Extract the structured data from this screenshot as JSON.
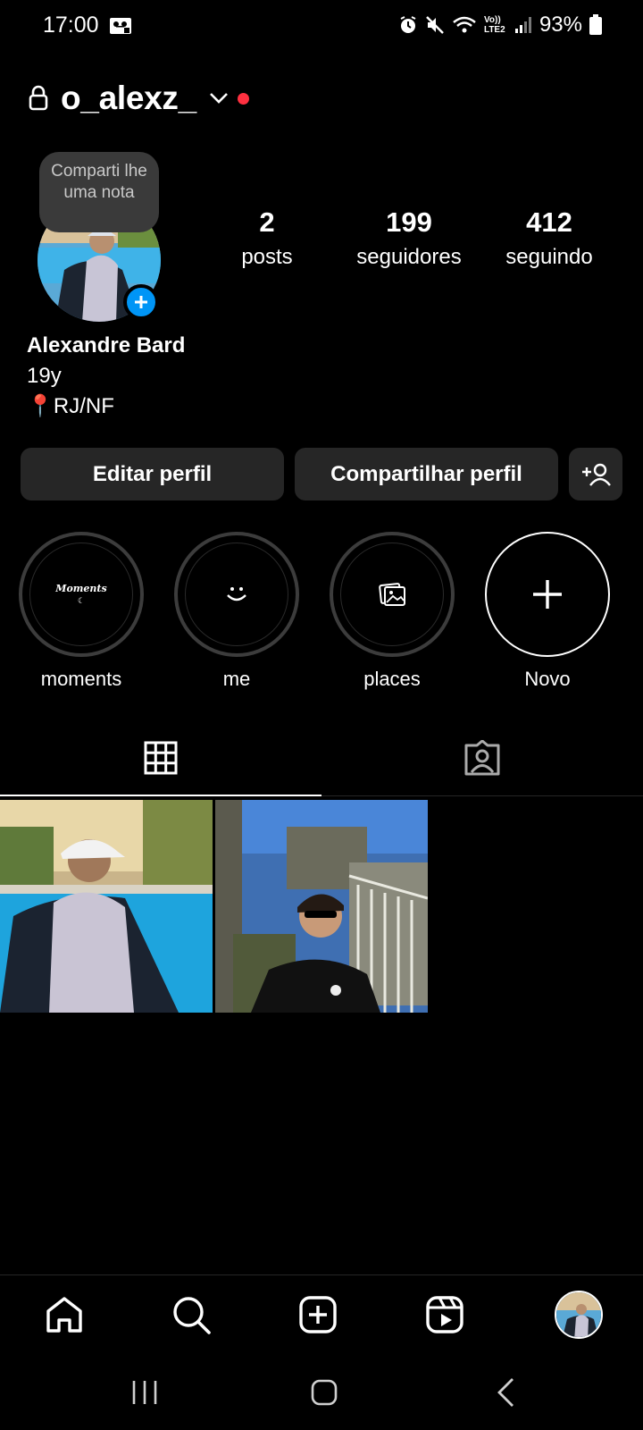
{
  "status_bar": {
    "time": "17:00",
    "battery": "93%",
    "network_label": "Vo)) LTE2",
    "icons": [
      "voicemail-icon",
      "alarm-icon",
      "mute-icon",
      "wifi-icon",
      "signal-icon",
      "battery-icon"
    ]
  },
  "header": {
    "username": "o_alexz_",
    "icons": [
      "lock-icon",
      "chevron-down-icon"
    ],
    "notification_dot_color": "#ff3040"
  },
  "note": {
    "text": "Comparti lhe uma nota"
  },
  "stats": [
    {
      "value": "2",
      "label": "posts"
    },
    {
      "value": "199",
      "label": "seguidores"
    },
    {
      "value": "412",
      "label": "seguindo"
    }
  ],
  "bio": {
    "name": "Alexandre Bard",
    "line1": "19y",
    "line2": "📍RJ/NF"
  },
  "buttons": {
    "edit": "Editar perfil",
    "share": "Compartilhar perfil",
    "add_person_icon": "add-person-icon"
  },
  "highlights": [
    {
      "label": "moments",
      "cover_text": "Moments"
    },
    {
      "label": "me",
      "cover_text": ""
    },
    {
      "label": "places",
      "cover_text": ""
    },
    {
      "label": "Novo",
      "cover_text": ""
    }
  ],
  "tabs": [
    {
      "icon": "grid-icon",
      "active": true
    },
    {
      "icon": "tagged-icon",
      "active": false
    }
  ],
  "bottom_nav": [
    "home-icon",
    "search-icon",
    "create-icon",
    "reels-icon",
    "profile-avatar"
  ],
  "colors": {
    "accent": "#0095f6",
    "button_bg": "#262626",
    "background": "#000000"
  }
}
